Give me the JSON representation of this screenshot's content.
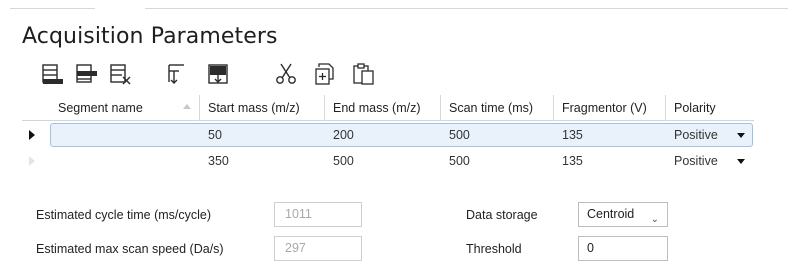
{
  "title": "Acquisition Parameters",
  "toolbar": {
    "icons": [
      "insert-segment-icon",
      "add-segment-icon",
      "delete-segment-icon",
      "import-icon",
      "save-icon",
      "cut-icon",
      "copy-icon",
      "paste-icon"
    ]
  },
  "table": {
    "headers": [
      "Segment name",
      "Start mass (m/z)",
      "End mass (m/z)",
      "Scan time (ms)",
      "Fragmentor (V)",
      "Polarity"
    ],
    "rows": [
      {
        "segment_name": "",
        "start_mass": "50",
        "end_mass": "200",
        "scan_time": "500",
        "fragmentor": "135",
        "polarity": "Positive",
        "selected": true
      },
      {
        "segment_name": "",
        "start_mass": "350",
        "end_mass": "500",
        "scan_time": "500",
        "fragmentor": "135",
        "polarity": "Positive",
        "selected": false
      }
    ]
  },
  "fields": {
    "cycle_time_label": "Estimated cycle time (ms/cycle)",
    "cycle_time_value": "1011",
    "scan_speed_label": "Estimated max scan speed (Da/s)",
    "scan_speed_value": "297",
    "data_storage_label": "Data storage",
    "data_storage_value": "Centroid",
    "threshold_label": "Threshold",
    "threshold_value": "0"
  },
  "colors": {
    "selection_fill": "#e9f2fb",
    "selection_border": "#9ec3e6",
    "icon_dark": "#2b2b2b"
  }
}
